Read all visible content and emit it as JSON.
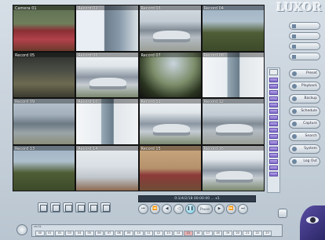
{
  "app": {
    "logo": "LUXOR"
  },
  "cameras": [
    {
      "label": "Camera 01",
      "scene": "s-flowers"
    },
    {
      "label": "Record 02",
      "scene": "s-wall"
    },
    {
      "label": "Record 03",
      "scene": "s-car"
    },
    {
      "label": "Record 04",
      "scene": "s-tree"
    },
    {
      "label": "Record 05",
      "scene": "s-dark"
    },
    {
      "label": "Record 06",
      "scene": "s-car2"
    },
    {
      "label": "Record 07",
      "scene": "s-dome"
    },
    {
      "label": "Record 08",
      "scene": "s-door"
    },
    {
      "label": "Record 09",
      "scene": "s-lot"
    },
    {
      "label": "Record 10",
      "scene": "s-door"
    },
    {
      "label": "Record 11",
      "scene": "s-car2"
    },
    {
      "label": "Record 12",
      "scene": "s-car"
    },
    {
      "label": "Record 13",
      "scene": "s-tree"
    },
    {
      "label": "Record 14",
      "scene": "s-room"
    },
    {
      "label": "Record 15",
      "scene": "s-brick"
    },
    {
      "label": "Record 16",
      "scene": "s-car2"
    }
  ],
  "right_panel": {
    "buttons": [
      "Preset",
      "Playback",
      "Backup",
      "Schedule",
      "Capture",
      "Search",
      "System",
      "Log Out"
    ]
  },
  "status_bar": {
    "text": "0:1/4/2/18 00:00:00 ... x1"
  },
  "playback": {
    "speed_label": "Pause"
  },
  "timeline": {
    "title": "ch:01",
    "hours": [
      "00",
      "01",
      "02",
      "03",
      "04",
      "05",
      "06",
      "07",
      "08",
      "09",
      "10",
      "11",
      "12",
      "13",
      "14",
      "15",
      "16",
      "17",
      "18",
      "19",
      "20",
      "21",
      "22",
      "23"
    ]
  }
}
